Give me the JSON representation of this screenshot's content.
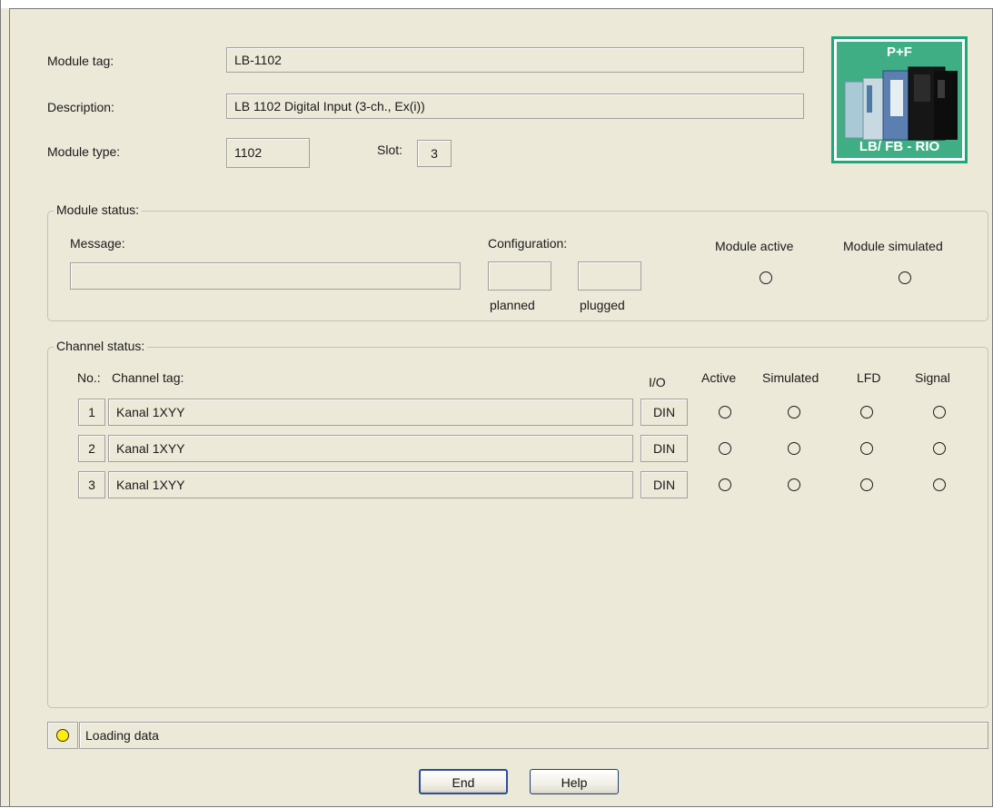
{
  "module": {
    "tag_label": "Module tag:",
    "tag_value": "LB-1102",
    "description_label": "Description:",
    "description_value": "LB 1102 Digital Input (3-ch., Ex(i))",
    "type_label": "Module type:",
    "type_value": "1102",
    "slot_label": "Slot:",
    "slot_value": "3"
  },
  "logo": {
    "top_text": "P+F",
    "bottom_text": "LB/ FB - RIO",
    "color": "#3fae85",
    "border_color": "#1da87a"
  },
  "module_status": {
    "title": "Module status:",
    "message_label": "Message:",
    "message_value": "",
    "configuration_label": "Configuration:",
    "planned_label": "planned",
    "plugged_label": "plugged",
    "planned_value": "",
    "plugged_value": "",
    "module_active_label": "Module active",
    "module_simulated_label": "Module simulated"
  },
  "channel_status": {
    "title": "Channel status:",
    "headers": {
      "no": "No.:",
      "tag": "Channel tag:",
      "io": "I/O",
      "active": "Active",
      "simulated": "Simulated",
      "lfd": "LFD",
      "signal": "Signal"
    },
    "rows": [
      {
        "no": "1",
        "tag": "Kanal 1XYY",
        "io": "DIN"
      },
      {
        "no": "2",
        "tag": "Kanal 1XYY",
        "io": "DIN"
      },
      {
        "no": "3",
        "tag": "Kanal 1XYY",
        "io": "DIN"
      }
    ]
  },
  "status_bar": {
    "text": "Loading data",
    "indicator_color": "#ffef00"
  },
  "buttons": {
    "end": "End",
    "help": "Help"
  }
}
